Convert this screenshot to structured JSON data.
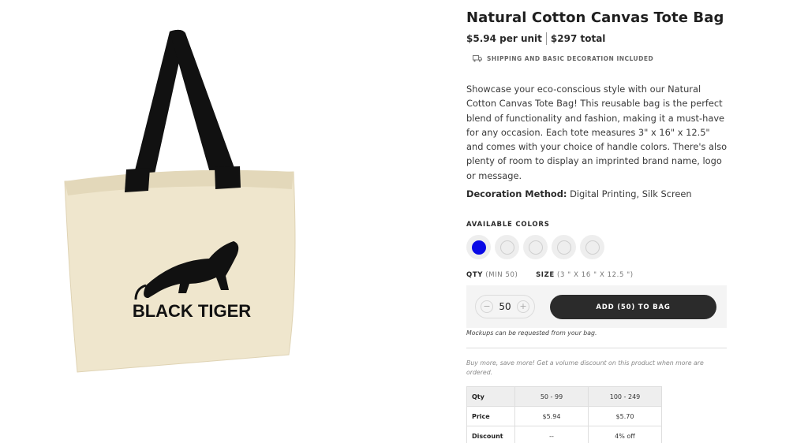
{
  "product": {
    "title": "Natural Cotton Canvas Tote Bag",
    "price_per_unit": "$5.94 per unit",
    "price_total": "$297 total",
    "shipping_note": "SHIPPING AND BASIC DECORATION INCLUDED",
    "description": "Showcase your eco-conscious style with our Natural Cotton Canvas Tote Bag! This reusable bag is the perfect blend of functionality and fashion, making it a must-have for any occasion. Each tote measures 3\" x 16\" x 12.5\" and comes with your choice of handle colors. There's also plenty of room to display an imprinted brand name, logo or message.",
    "decoration_label": "Decoration Method:",
    "decoration_value": " Digital Printing, Silk Screen",
    "image_brand_text": "BLACK TIGER"
  },
  "colors": {
    "label": "AVAILABLE COLORS",
    "swatches": [
      {
        "color": "#0a0ae6",
        "selected": true
      },
      {
        "color": "#eeeeee",
        "selected": false
      },
      {
        "color": "#eeeeee",
        "selected": false
      },
      {
        "color": "#eeeeee",
        "selected": false
      },
      {
        "color": "#eeeeee",
        "selected": false
      }
    ]
  },
  "order": {
    "qty_label": "QTY",
    "qty_min": "(MIN 50)",
    "size_label": "SIZE",
    "size_value": "(3 \" X 16 \" X 12.5 \")",
    "quantity": "50",
    "minus": "−",
    "plus": "+",
    "add_button": "ADD (50) TO BAG",
    "mockups_note": "Mockups can be requested from your bag.",
    "volume_note": "Buy more, save more! Get a volume discount on this product when more are ordered."
  },
  "pricing_table": {
    "rows": [
      {
        "label": "Qty",
        "values": [
          "50 - 99",
          "100 - 249"
        ]
      },
      {
        "label": "Price",
        "values": [
          "$5.94",
          "$5.70"
        ]
      },
      {
        "label": "Discount",
        "values": [
          "--",
          "4% off"
        ]
      }
    ]
  },
  "colors_theme": {
    "accent_dark": "#2b2b2b",
    "selected_swatch": "#0a0ae6",
    "bag_canvas": "#efe6cd",
    "bag_handle": "#111111"
  }
}
